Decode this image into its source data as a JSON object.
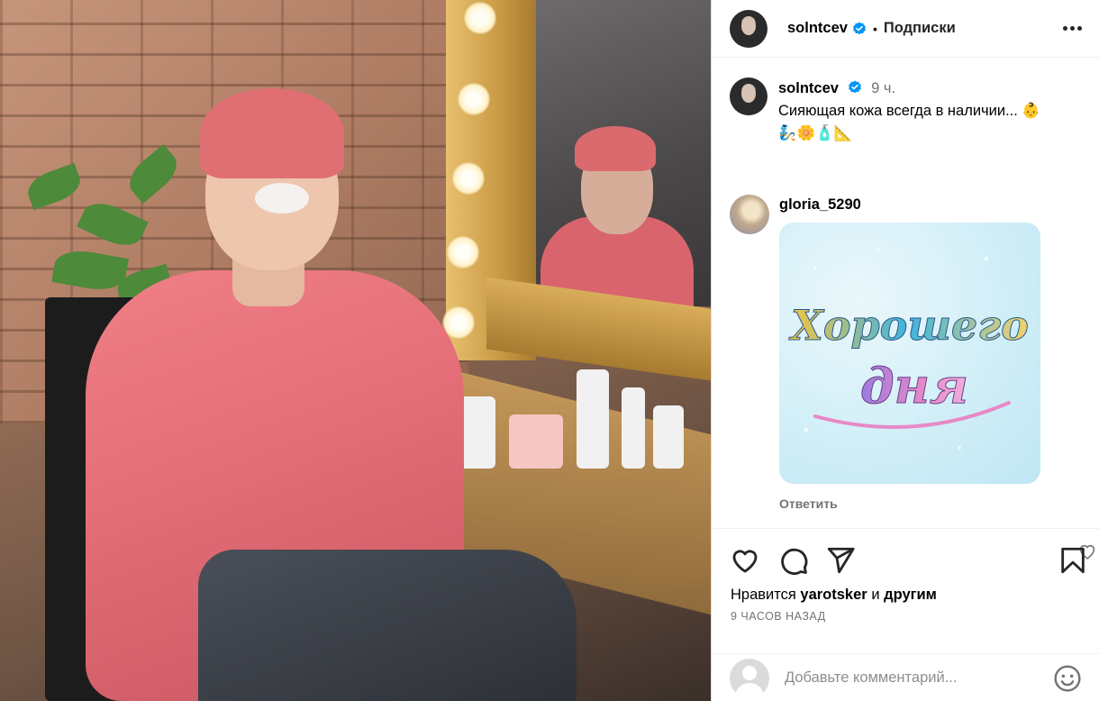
{
  "post": {
    "author": "solntcev",
    "follow_label": "Подписки",
    "separator": "•",
    "caption_time": "9 ч.",
    "caption_line1": "Сияющая кожа всегда в наличии... 👶",
    "caption_line2": "🧞🌼🧴📐"
  },
  "comment": {
    "user": "gloria_5290",
    "sticker_text_line1": "Хорошего",
    "sticker_text_line2": "дня",
    "reply_label": "Ответить"
  },
  "footer": {
    "likes_prefix": "Нравится",
    "likes_user": "yarotsker",
    "likes_conj": "и",
    "likes_rest": "другим",
    "timestamp": "9 ЧАСОВ НАЗАД",
    "comment_placeholder": "Добавьте комментарий..."
  },
  "icons": [
    "verified-icon",
    "more-icon",
    "heart-icon",
    "comment-icon",
    "share-icon",
    "bookmark-icon",
    "emoji-icon"
  ],
  "colors": {
    "verified": "#0095f6",
    "muted": "#737373",
    "border": "#dbdbdb"
  }
}
